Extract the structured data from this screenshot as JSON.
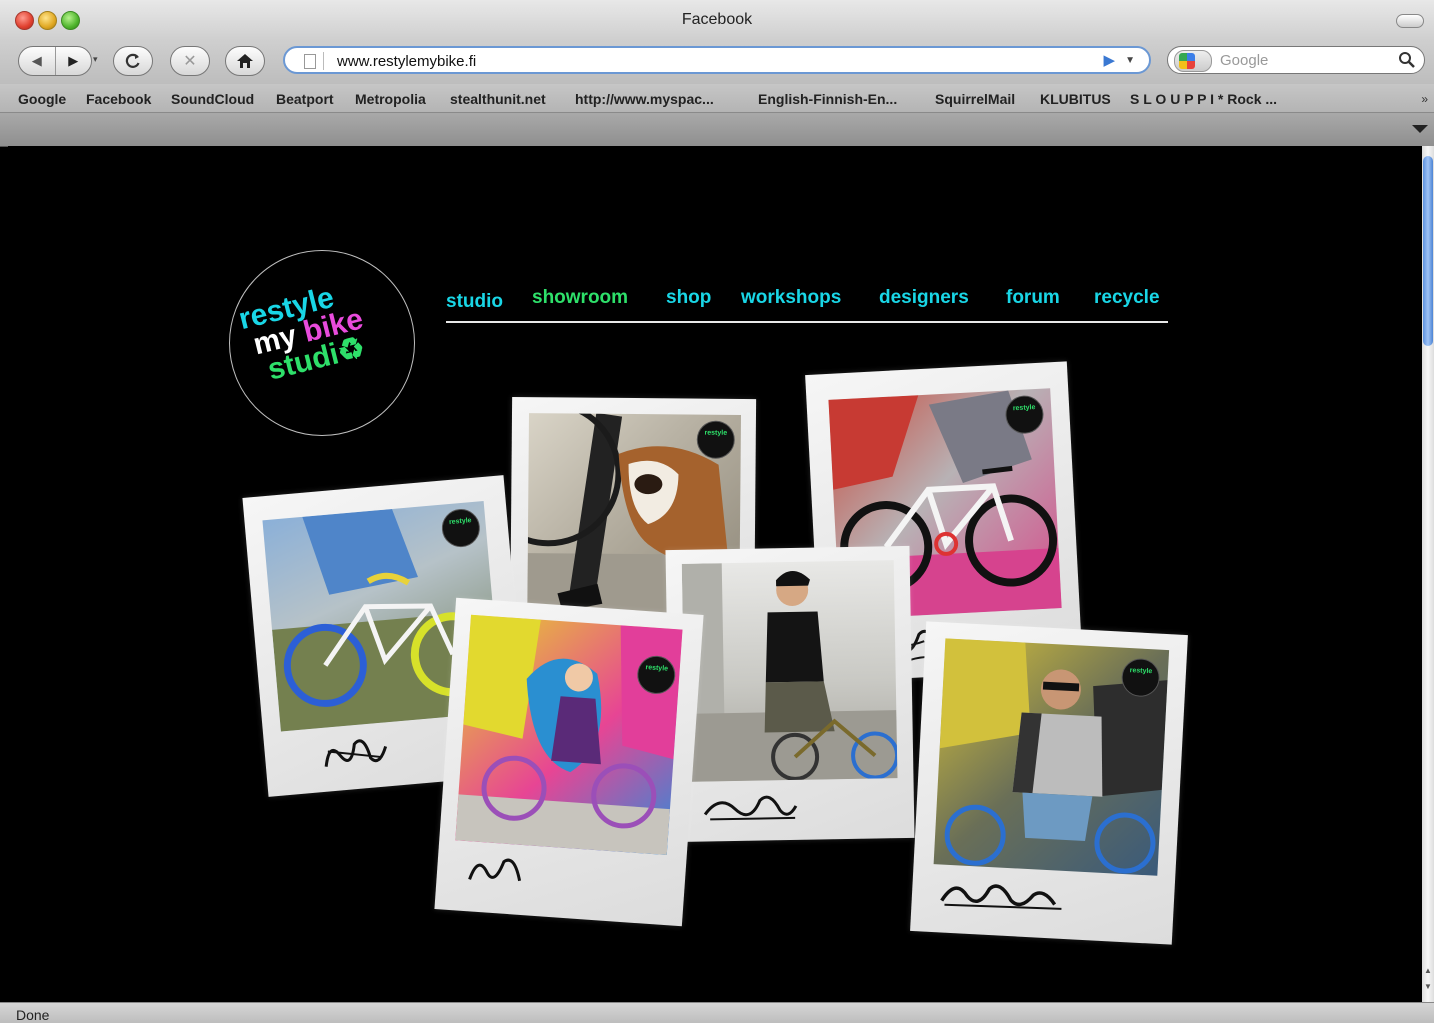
{
  "window": {
    "title": "Facebook"
  },
  "toolbar": {
    "back_label": "◀",
    "forward_label": "▶",
    "reload_label": "C",
    "stop_label": "✕",
    "home_label": "⌂",
    "url": "www.restylemybike.fi",
    "go_label": "▶",
    "search_placeholder": "Google"
  },
  "bookmarks": [
    "Google",
    "Facebook",
    "SoundCloud",
    "Beatport",
    "Metropolia",
    "stealthunit.net",
    "http://www.myspac...",
    "English-Finnish-En...",
    "SquirrelMail",
    "KLUBITUS",
    "S L O U P P I * Rock ..."
  ],
  "bookmarks_more": "»",
  "status": {
    "text": "Done"
  },
  "site": {
    "logo": {
      "line1": "restyle",
      "line2a": "my",
      "line2b": "bike",
      "line3": "studi",
      "recycle": "♻"
    },
    "nav": [
      {
        "label": "studio",
        "color": "#19d6e6"
      },
      {
        "label": "showroom",
        "color": "#2ee06a"
      },
      {
        "label": "shop",
        "color": "#19d6e6"
      },
      {
        "label": "workshops",
        "color": "#19d6e6"
      },
      {
        "label": "designers",
        "color": "#19d6e6"
      },
      {
        "label": "forum",
        "color": "#19d6e6"
      },
      {
        "label": "recycle",
        "color": "#19d6e6"
      }
    ],
    "mini_logo": {
      "l1": "restyle",
      "l2": "my bike",
      "l3": "studio"
    }
  },
  "colors": {
    "accent_cyan": "#19d6e6",
    "accent_green": "#2ee06a",
    "accent_pink": "#e84bdc"
  }
}
